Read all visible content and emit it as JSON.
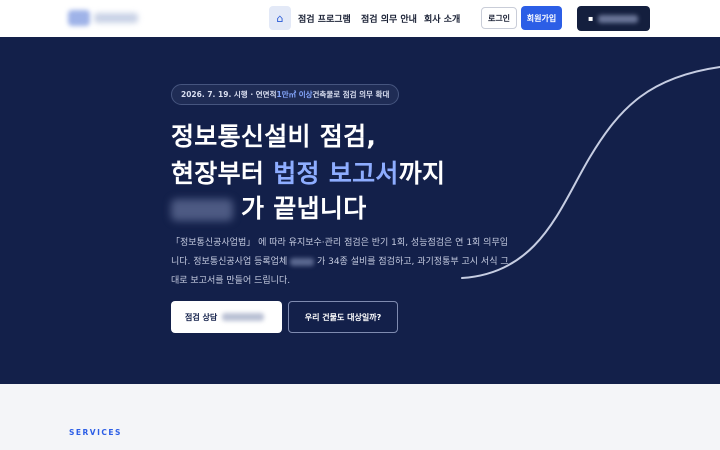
{
  "header": {
    "home_icon": "home-icon",
    "nav": [
      "점검 프로그램",
      "점검 의무 안내",
      "회사 소개"
    ],
    "login_label": "로그인",
    "signup_label": "회원가입",
    "dark_button_icon": "building-icon"
  },
  "hero": {
    "notice_prefix": "2026. 7. 19. 시행 · 연면적 ",
    "notice_highlight": "1만㎡ 이상",
    "notice_suffix": " 건축물로 점검 의무 확대",
    "title_line1": "정보통신설비 점검,",
    "title_line2_a": "현장부터 ",
    "title_line2_accent": "법정 보고서",
    "title_line2_b": "까지",
    "title_line3": "가 끝냅니다",
    "desc_part1": "「정보통신공사업법」 에 따라 유지보수·관리 점검은 반기 1회, 성능점검은 연 1회 의무입니다. 정보통신공사업 등록업체 ",
    "desc_part2": " 가 34종 설비를 점검하고, 과기정통부 고시 서식 그대로 보고서를 만들어 드립니다.",
    "cta_primary": "점검 상담",
    "cta_secondary": "우리 건물도 대상일까?"
  },
  "services": {
    "label": "SERVICES"
  },
  "colors": {
    "hero_bg": "#13204a",
    "accent": "#2c5ee6",
    "accent_light": "#8eadff"
  }
}
